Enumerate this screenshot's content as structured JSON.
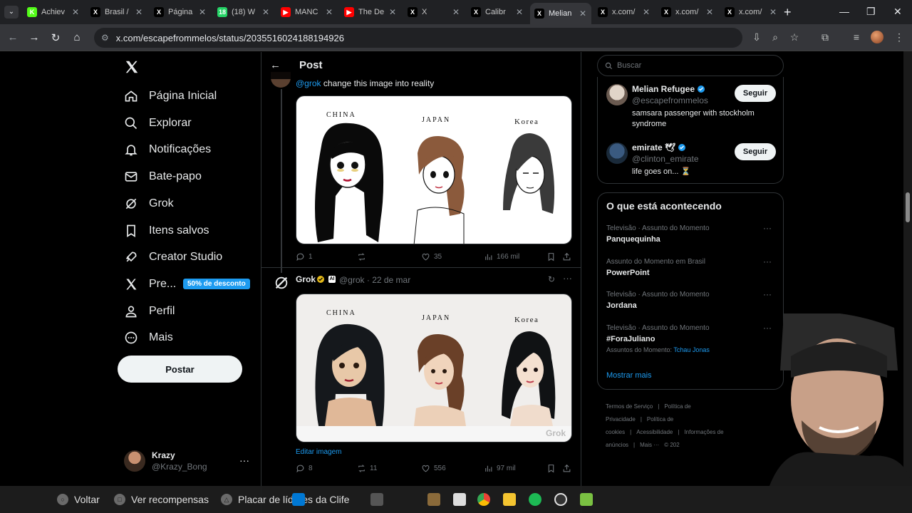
{
  "browser": {
    "tabs": [
      {
        "title": "Achiev",
        "fav": "K",
        "color": "#53fc18"
      },
      {
        "title": "Brasil /",
        "fav": "X",
        "color": "#000000"
      },
      {
        "title": "Página",
        "fav": "X",
        "color": "#000000"
      },
      {
        "title": "(18) W",
        "fav": "18",
        "color": "#25d366"
      },
      {
        "title": "MANC",
        "fav": "▶",
        "color": "#ff0000"
      },
      {
        "title": "The De",
        "fav": "▶",
        "color": "#ff0000"
      },
      {
        "title": "X",
        "fav": "X",
        "color": "#000000"
      },
      {
        "title": "Calibr",
        "fav": "X",
        "color": "#000000"
      },
      {
        "title": "Melian",
        "fav": "X",
        "color": "#000000"
      },
      {
        "title": "x.com/",
        "fav": "X",
        "color": "#000000"
      },
      {
        "title": "x.com/",
        "fav": "X",
        "color": "#000000"
      },
      {
        "title": "x.com/",
        "fav": "X",
        "color": "#000000"
      }
    ],
    "active_tab_index": 8,
    "url": "x.com/escapefrommelos/status/2035516024188194926"
  },
  "sidebar": {
    "items": [
      {
        "label": "Página Inicial",
        "icon": "home-icon"
      },
      {
        "label": "Explorar",
        "icon": "search-icon"
      },
      {
        "label": "Notificações",
        "icon": "bell-icon"
      },
      {
        "label": "Bate-papo",
        "icon": "mail-icon"
      },
      {
        "label": "Grok",
        "icon": "grok-icon"
      },
      {
        "label": "Itens salvos",
        "icon": "bookmark-icon"
      },
      {
        "label": "Creator Studio",
        "icon": "rocket-icon"
      },
      {
        "label": "Pre...",
        "icon": "x-premium-icon"
      },
      {
        "label": "Perfil",
        "icon": "person-icon"
      },
      {
        "label": "Mais",
        "icon": "more-circle-icon"
      }
    ],
    "premium_badge": "50% de desconto",
    "post_button": "Postar",
    "account": {
      "name": "Krazy",
      "handle": "@Krazy_Bong"
    }
  },
  "post": {
    "header_title": "Post",
    "original": {
      "mention": "@grok",
      "text": " change this image into reality",
      "image_labels": [
        "CHINA",
        "JAPAN",
        "Korea"
      ],
      "stats": {
        "replies": "1",
        "reposts": "",
        "likes": "35",
        "views": "166 mil"
      }
    },
    "reply": {
      "name": "Grok",
      "meta": "@grok · 22 de mar",
      "ai_badge": "AI",
      "image_labels": [
        "CHINA",
        "JAPAN",
        "Korea"
      ],
      "watermark": "Grok",
      "edit_link": "Editar imagem",
      "stats": {
        "replies": "8",
        "reposts": "11",
        "likes": "556",
        "views": "97 mil"
      }
    }
  },
  "right": {
    "search_placeholder": "Buscar",
    "who_to_follow": [
      {
        "name": "Melian Refugee",
        "handle": "@escapefrommelos",
        "bio": "samsara passenger with stockholm syndrome",
        "button": "Seguir"
      },
      {
        "name": "emirate 🕊",
        "handle": "@clinton_emirate",
        "bio": "life goes on... ⏳",
        "button": "Seguir"
      }
    ],
    "trends_title": "O que está acontecendo",
    "trends": [
      {
        "category": "Televisão · Assunto do Momento",
        "name": "Panquequinha",
        "sub": "",
        "sub_link": ""
      },
      {
        "category": "Assunto do Momento em Brasil",
        "name": "PowerPoint",
        "sub": "",
        "sub_link": ""
      },
      {
        "category": "Televisão · Assunto do Momento",
        "name": "Jordana",
        "sub": "",
        "sub_link": ""
      },
      {
        "category": "Televisão · Assunto do Momento",
        "name": "#ForaJuliano",
        "sub": "Assuntos do Momento: ",
        "sub_link": "Tchau Jonas"
      }
    ],
    "show_more": "Mostrar mais",
    "footer": [
      "Termos de Serviço",
      "|",
      "Política de Privacidade",
      "|",
      "Política de cookies",
      "|",
      "Acessibilidade",
      "|",
      "Informações de anúncios",
      "|",
      "Mais ···",
      "© 202"
    ]
  },
  "overlay": {
    "hints": [
      {
        "label": "Voltar",
        "button": "○"
      },
      {
        "label": "Ver recompensas",
        "button": "□"
      },
      {
        "label": "Placar de líderes da Clife",
        "button": "△"
      }
    ]
  },
  "colors": {
    "accent": "#1d9bf0",
    "background": "#000000",
    "border": "#2f3336",
    "muted": "#71767b"
  }
}
